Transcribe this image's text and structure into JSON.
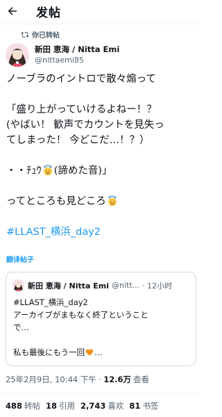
{
  "header": {
    "title": "发帖"
  },
  "repost": {
    "label": "你已转帖"
  },
  "author": {
    "name": "新田 恵海 / Nitta Emi",
    "handle": "@nittaemi85"
  },
  "post": {
    "lines": [
      "ノーブラのイントロで散々煽って",
      "「盛り上がっていけるよねー！？",
      "(やばい！ 歓声でカウントを見失っ",
      "てしまった！ 今どこだ…！？）",
      "・・ﾁｭｳ",
      "(諦めた音)」",
      "ってところも見どころ"
    ],
    "hashtag": "#LLAST_横浜_day2"
  },
  "translate_label": "翻译帖子",
  "quote": {
    "name": "新田 恵海 / Nitta Emi",
    "handle": "@nitt...",
    "time": "· 12小时",
    "lines": [
      "#LLAST_横浜_day2",
      "アーカイブがまもなく終了ということ",
      "で…",
      "私も最後にもう一回",
      "…"
    ]
  },
  "meta": {
    "timestamp": "25年2月9日, 10:44 下午 ·",
    "views": "12.6万",
    "views_label": "查看"
  },
  "stats": {
    "reposts": "488",
    "reposts_label": "转帖",
    "quotes": "18",
    "quotes_label": "引用",
    "likes": "2,743",
    "likes_label": "喜欢",
    "bookmarks": "81",
    "bookmarks_label": "书签"
  },
  "colors": {
    "link": "#1d9bf0",
    "text": "#0f1419",
    "secondary": "#536471",
    "border": "#cfd9de",
    "heart": "#f4900c"
  },
  "icons": [
    "back-arrow-icon",
    "repost-icon",
    "angel-emoji-icon",
    "orange-heart-icon"
  ]
}
